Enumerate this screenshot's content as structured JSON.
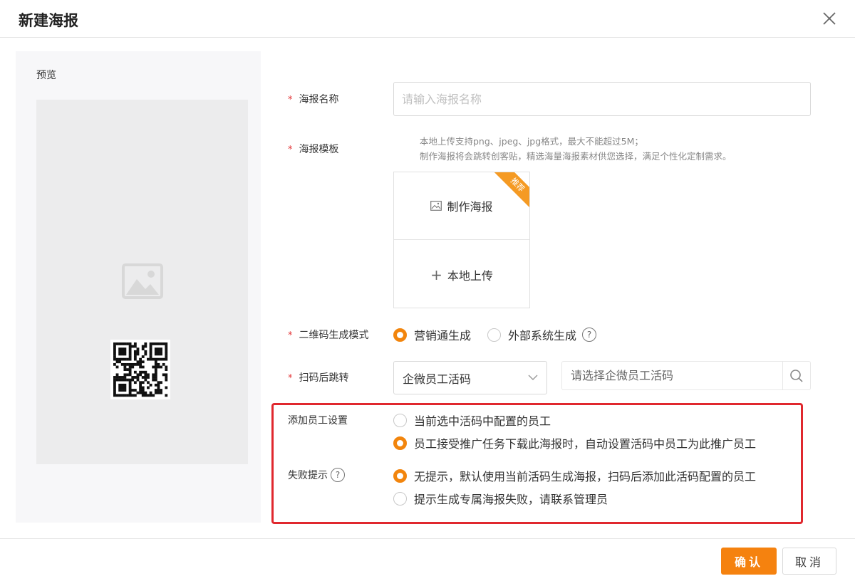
{
  "dialog": {
    "title": "新建海报"
  },
  "preview": {
    "label": "预览"
  },
  "form": {
    "required_mark": "*",
    "poster_name": {
      "label": "海报名称",
      "placeholder": "请输入海报名称"
    },
    "poster_template": {
      "label": "海报模板",
      "hint_line1": "本地上传支持png、jpeg、jpg格式，最大不能超过5M；",
      "hint_line2": "制作海报将会跳转创客贴，精选海量海报素材供您选择，满足个性化定制需求。",
      "make_label": "制作海报",
      "badge": "推荐",
      "upload_plus": "+",
      "upload_label": "本地上传"
    },
    "qr_mode": {
      "label": "二维码生成模式",
      "options": [
        {
          "label": "营销通生成",
          "selected": true
        },
        {
          "label": "外部系统生成",
          "selected": false
        }
      ],
      "help": "?"
    },
    "redirect": {
      "label": "扫码后跳转",
      "select_value": "企微员工活码",
      "search_placeholder": "请选择企微员工活码"
    },
    "add_staff": {
      "label": "添加员工设置",
      "options": [
        {
          "label": "当前选中活码中配置的员工",
          "selected": false
        },
        {
          "label": "员工接受推广任务下载此海报时，自动设置活码中员工为此推广员工",
          "selected": true
        }
      ]
    },
    "fail_hint": {
      "label": "失败提示",
      "help": "?",
      "options": [
        {
          "label": "无提示，默认使用当前活码生成海报，扫码后添加此活码配置的员工",
          "selected": true
        },
        {
          "label": "提示生成专属海报失败，请联系管理员",
          "selected": false
        }
      ]
    }
  },
  "footer": {
    "confirm": "确认",
    "cancel": "取消"
  },
  "colors": {
    "accent": "#f5820f",
    "highlight": "#e0282e",
    "required": "#e4393c"
  }
}
